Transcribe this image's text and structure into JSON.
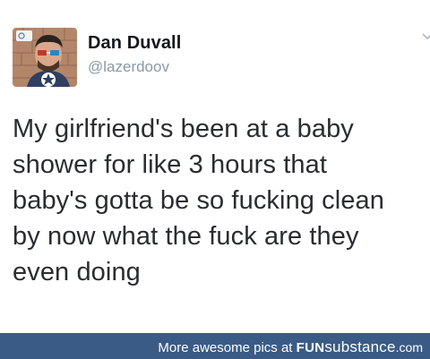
{
  "tweet": {
    "display_name": "Dan Duvall",
    "handle": "@lazerdoov",
    "text": "My girlfriend's been at a baby\nshower for like 3 hours that\nbaby's gotta be so fucking clean\nby now what the fuck are they\neven doing"
  },
  "icons": {
    "avatar": "profile-photo",
    "more": "chevron-down-icon"
  },
  "footer": {
    "lead": "More awesome pics at ",
    "brand_bold": "FUN",
    "brand_light": "substance",
    "brand_tld": ".com"
  },
  "colors": {
    "footer_bg": "#3a5b86",
    "handle": "#8899a6",
    "text": "#2a2d30"
  }
}
